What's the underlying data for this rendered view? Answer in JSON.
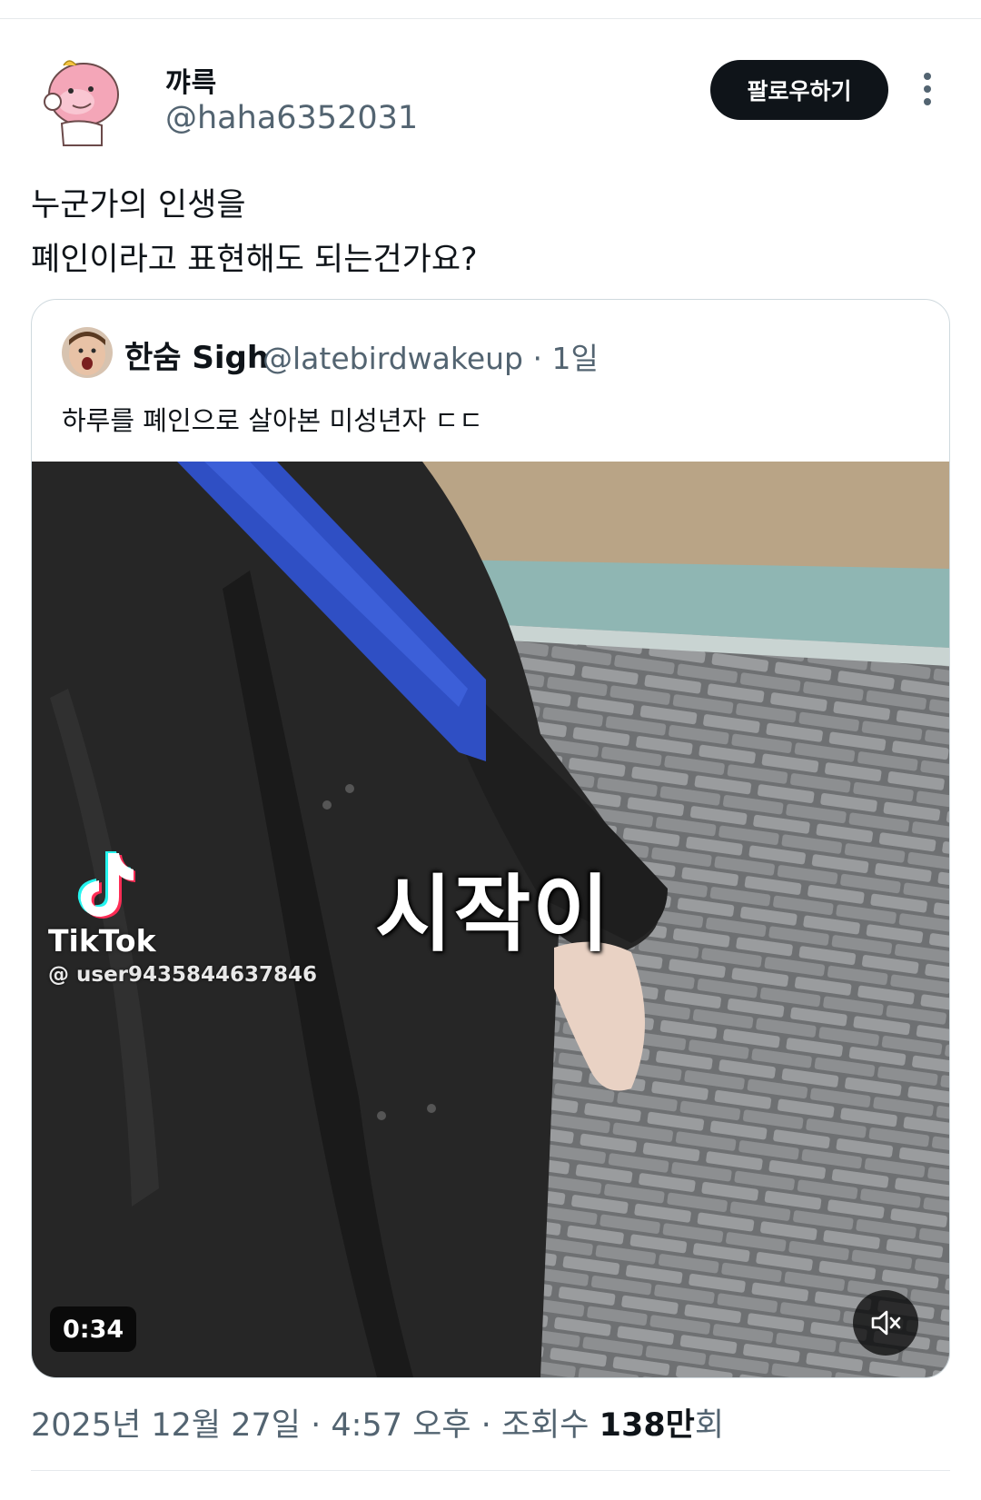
{
  "tweet": {
    "author": {
      "display_name": "꺄륵",
      "handle": "@haha6352031"
    },
    "follow_label": "팔로우하기",
    "more_icon": "more-vertical-icon",
    "text_lines": [
      "누군가의 인생을",
      "폐인이라고 표현해도 되는건가요?"
    ]
  },
  "quote": {
    "display_name": "한숨 Sigh",
    "handle_time": "@latebirdwakeup · 1일",
    "text": "하루를 폐인으로 살아본 미성년자 ㄷㄷ",
    "video": {
      "watermark_name": "TikTok",
      "watermark_user": "@ user9435844637846",
      "caption": "시작이",
      "duration": "0:34",
      "mute_icon": "speaker-muted-icon"
    }
  },
  "meta": {
    "datetime": "2025년 12월 27일 · 4:57 오후 · 조회수",
    "views": "138만",
    "views_suffix": "회"
  },
  "colors": {
    "primary_text": "#0f1419",
    "secondary_text": "#536471",
    "border": "#cfd9de",
    "button_bg": "#0f1419"
  }
}
